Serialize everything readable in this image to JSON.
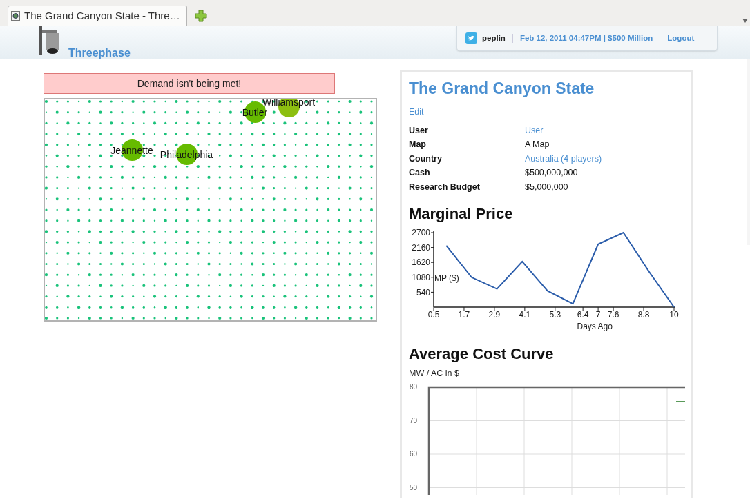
{
  "browser": {
    "tabs": [
      {
        "title": "The Grand Canyon State - Thre…",
        "selected": true
      }
    ]
  },
  "header": {
    "site_name": "Threephase",
    "user": "peplin",
    "status": "Feb 12, 2011 04:47PM | $500 Million",
    "logout": "Logout"
  },
  "alert": "Demand isn't being met!",
  "map": {
    "cities": [
      {
        "name": "Butler",
        "color": "#66bb00"
      },
      {
        "name": "Williamsport",
        "color": "#8dbf10"
      },
      {
        "name": "Jeannette",
        "color": "#66bb00"
      },
      {
        "name": "Philadelphia",
        "color": "#66bb00"
      }
    ]
  },
  "details": {
    "title": "The Grand Canyon State",
    "edit": "Edit",
    "fields": [
      {
        "label": "User",
        "value": "User",
        "link": true
      },
      {
        "label": "Map",
        "value": "A Map",
        "link": false
      },
      {
        "label": "Country",
        "value": "Australia (4 players)",
        "link": true
      },
      {
        "label": "Cash",
        "value": "$500,000,000",
        "link": false
      },
      {
        "label": "Research Budget",
        "value": "$5,000,000",
        "link": false
      }
    ]
  },
  "marginal_price": {
    "heading": "Marginal Price",
    "chart_data": {
      "type": "line",
      "xlabel": "Days Ago",
      "ylabel": "MP ($)",
      "x": [
        1,
        2,
        3,
        4,
        5,
        6,
        7,
        8,
        9,
        10
      ],
      "xlim": [
        0.5,
        10
      ],
      "ylim": [
        0,
        2700
      ],
      "xticks": [
        0.5,
        1.7,
        2.9,
        4.1,
        5.3,
        6.4,
        7,
        7.6,
        8.8,
        10
      ],
      "yticks": [
        540,
        1080,
        1620,
        2160,
        2700
      ],
      "series": [
        {
          "color": "#2a5caa",
          "values": [
            2230,
            1080,
            660,
            1650,
            590,
            120,
            2280,
            2700,
            1300,
            0
          ]
        }
      ]
    }
  },
  "average_cost": {
    "heading": "Average Cost Curve",
    "subtitle": "MW / AC in $",
    "y_tick_labels": [
      "80",
      "70",
      "60",
      "50"
    ]
  }
}
